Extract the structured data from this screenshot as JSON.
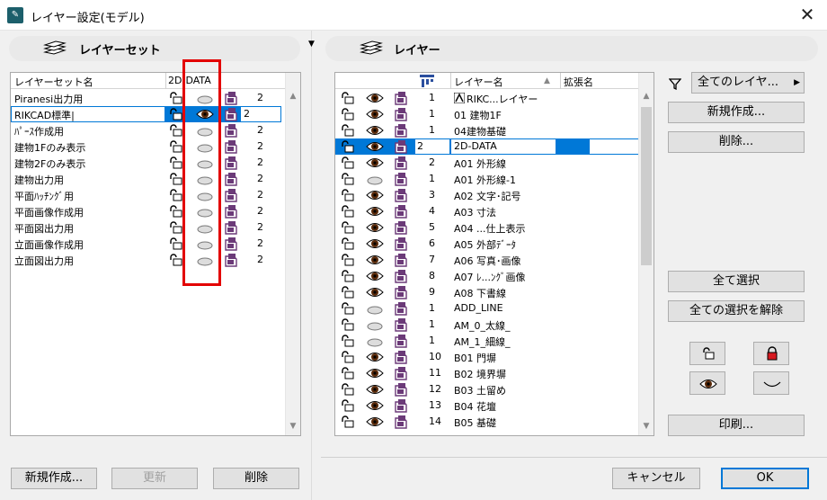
{
  "window": {
    "title": "レイヤー設定(モデル)",
    "close": "✕",
    "app_icon": "archicad-logo-icon"
  },
  "left_pane": {
    "title": "レイヤーセット",
    "columns": {
      "name": "レイヤーセット名",
      "data": "2D-DATA"
    },
    "rows": [
      {
        "name": "Piranesi出力用",
        "num": "2"
      },
      {
        "name": "RIKCAD標準|",
        "num": "2",
        "selected": true
      },
      {
        "name": "ﾊﾟｰｽ作成用",
        "num": "2"
      },
      {
        "name": "建物1Fのみ表示",
        "num": "2"
      },
      {
        "name": "建物2Fのみ表示",
        "num": "2"
      },
      {
        "name": "建物出力用",
        "num": "2"
      },
      {
        "name": "平面ﾊｯﾁﾝｸﾞ用",
        "num": "2"
      },
      {
        "name": "平面画像作成用",
        "num": "2"
      },
      {
        "name": "平面図出力用",
        "num": "2"
      },
      {
        "name": "立面画像作成用",
        "num": "2"
      },
      {
        "name": "立面図出力用",
        "num": "2"
      }
    ],
    "buttons": {
      "new": "新規作成...",
      "update": "更新",
      "delete": "削除"
    }
  },
  "right_pane": {
    "title": "レイヤー",
    "columns": {
      "name": "レイヤー名",
      "ext": "拡張名"
    },
    "rows": [
      {
        "num": "1",
        "name": "RIKC...レイヤー",
        "eye": true,
        "system": true
      },
      {
        "num": "1",
        "name": "01 建物1F",
        "eye": true
      },
      {
        "num": "1",
        "name": "04建物基礎",
        "eye": true
      },
      {
        "num": "2",
        "name": "2D-DATA",
        "eye": true,
        "selected": true
      },
      {
        "num": "2",
        "name": "A01 外形線",
        "eye": true
      },
      {
        "num": "1",
        "name": "A01 外形線-1",
        "eye": false
      },
      {
        "num": "3",
        "name": "A02 文字･記号",
        "eye": true
      },
      {
        "num": "4",
        "name": "A03 寸法",
        "eye": true
      },
      {
        "num": "5",
        "name": "A04 ...仕上表示",
        "eye": true
      },
      {
        "num": "6",
        "name": "A05 外部ﾃﾞｰﾀ",
        "eye": true
      },
      {
        "num": "7",
        "name": "A06 写真･画像",
        "eye": true
      },
      {
        "num": "8",
        "name": "A07 ﾚ...ﾝｸﾞ画像",
        "eye": true
      },
      {
        "num": "9",
        "name": "A08 下書線",
        "eye": true
      },
      {
        "num": "1",
        "name": "ADD_LINE",
        "eye": false
      },
      {
        "num": "1",
        "name": "AM_0_太線_",
        "eye": false
      },
      {
        "num": "1",
        "name": "AM_1_細線_",
        "eye": false
      },
      {
        "num": "10",
        "name": "B01 門塀",
        "eye": true
      },
      {
        "num": "11",
        "name": "B02 境界塀",
        "eye": true
      },
      {
        "num": "12",
        "name": "B03 土留め",
        "eye": true
      },
      {
        "num": "13",
        "name": "B04 花壇",
        "eye": true
      },
      {
        "num": "14",
        "name": "B05 基礎",
        "eye": true
      }
    ],
    "filter": "全てのレイヤ...",
    "buttons": {
      "new": "新規作成...",
      "delete": "削除...",
      "select_all": "全て選択",
      "deselect_all": "全ての選択を解除",
      "print": "印刷...",
      "cancel": "キャンセル",
      "ok": "OK"
    }
  },
  "colors": {
    "highlight": "#0078d7",
    "red_box": "#e30000",
    "eye_iris": "#5a2a0a",
    "doc_purple": "#6b3a78"
  }
}
